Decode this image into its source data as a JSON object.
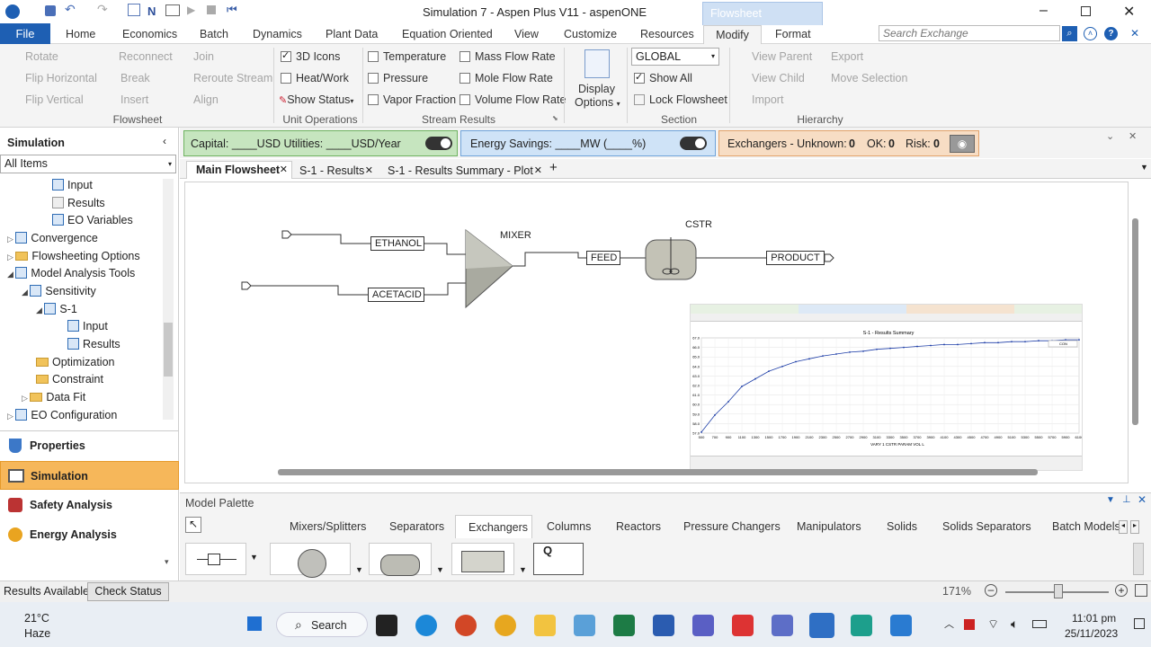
{
  "window": {
    "title": "Simulation 7 - Aspen Plus V11 - aspenONE",
    "context_tab": "Flowsheet"
  },
  "menu": {
    "file": "File",
    "items": [
      "Home",
      "Economics",
      "Batch",
      "Dynamics",
      "Plant Data",
      "Equation Oriented",
      "View",
      "Customize",
      "Resources",
      "Modify",
      "Format"
    ],
    "search_placeholder": "Search Exchange"
  },
  "ribbon": {
    "flowsheet": {
      "rotate": "Rotate",
      "reconnect": "Reconnect",
      "join": "Join",
      "flip_h": "Flip Horizontal",
      "break": "Break",
      "reroute": "Reroute Stream",
      "flip_v": "Flip Vertical",
      "insert": "Insert",
      "align": "Align",
      "group": "Flowsheet"
    },
    "unitops": {
      "icons3d": "3D Icons",
      "heatwork": "Heat/Work",
      "showstatus": "Show Status",
      "group": "Unit Operations"
    },
    "stream": {
      "temperature": "Temperature",
      "pressure": "Pressure",
      "vaporfrac": "Vapor Fraction",
      "massflow": "Mass Flow Rate",
      "moleflow": "Mole Flow Rate",
      "volflow": "Volume Flow Rate",
      "group": "Stream Results"
    },
    "display": {
      "label1": "Display",
      "label2": "Options"
    },
    "section": {
      "select": "GLOBAL",
      "showall": "Show All",
      "lock": "Lock Flowsheet",
      "group": "Section"
    },
    "hierarchy": {
      "viewparent": "View Parent",
      "export": "Export",
      "viewchild": "View Child",
      "moveselection": "Move Selection",
      "import": "Import",
      "group": "Hierarchy"
    }
  },
  "left": {
    "header": "Simulation",
    "filter": "All Items",
    "tree": [
      "Input",
      "Results",
      "EO Variables",
      "Convergence",
      "Flowsheeting Options",
      "Model Analysis Tools",
      "Sensitivity",
      "S-1",
      "Input",
      "Results",
      "Optimization",
      "Constraint",
      "Data Fit",
      "EO Configuration"
    ],
    "nav": [
      "Properties",
      "Simulation",
      "Safety Analysis",
      "Energy Analysis"
    ]
  },
  "bars": {
    "capital": "Capital: ____USD  Utilities: ____USD/Year",
    "energy": "Energy Savings: ____MW   (____%)",
    "exchangers": "Exchangers -  Unknown:",
    "unknown": "0",
    "ok_label": "OK:",
    "ok": "0",
    "risk_label": "Risk:",
    "risk": "0"
  },
  "tabs": [
    "Main Flowsheet",
    "S-1 - Results",
    "S-1 - Results Summary - Plot"
  ],
  "flowsheet": {
    "ethanol": "ETHANOL",
    "acetacid": "ACETACID",
    "mixer": "MIXER",
    "feed": "FEED",
    "cstr": "CSTR",
    "product": "PRODUCT"
  },
  "inset": {
    "title": "S-1 - Results Summary",
    "xlabel": "VARY  1 CSTR  PARAM  VOL  L",
    "legend": "CON",
    "chart_data": {
      "type": "line",
      "title": "S-1 - Results Summary",
      "x": [
        500,
        700,
        900,
        1100,
        1300,
        1500,
        1700,
        1900,
        2100,
        2300,
        2500,
        2700,
        2900,
        3100,
        3300,
        3500,
        3700,
        3900,
        4100,
        4300,
        4500,
        4700,
        4900,
        5100,
        5300,
        5500,
        5700,
        5900,
        6100
      ],
      "y": [
        57.1,
        58.9,
        60.3,
        61.9,
        62.7,
        63.5,
        64.0,
        64.5,
        64.8,
        65.1,
        65.3,
        65.5,
        65.6,
        65.8,
        65.9,
        66.0,
        66.1,
        66.2,
        66.3,
        66.3,
        66.4,
        66.5,
        66.5,
        66.6,
        66.6,
        66.7,
        66.7,
        66.8,
        66.8
      ],
      "ylim": [
        57.0,
        67.0
      ],
      "yticks": [
        "57.0",
        "58.0",
        "59.0",
        "60.0",
        "61.0",
        "62.0",
        "63.0",
        "64.0",
        "65.0",
        "66.0",
        "67.0"
      ],
      "series": [
        {
          "name": "CON"
        }
      ]
    }
  },
  "palette": {
    "title": "Model Palette",
    "tabs": [
      "Mixers/Splitters",
      "Separators",
      "Exchangers",
      "Columns",
      "Reactors",
      "Pressure Changers",
      "Manipulators",
      "Solids",
      "Solids Separators",
      "Batch Models"
    ]
  },
  "status": {
    "left": "Results Available",
    "check": "Check Status",
    "zoom": "171%"
  },
  "taskbar": {
    "temp": "21°C",
    "weather": "Haze",
    "search": "Search",
    "time": "11:01 pm",
    "date": "25/11/2023"
  }
}
